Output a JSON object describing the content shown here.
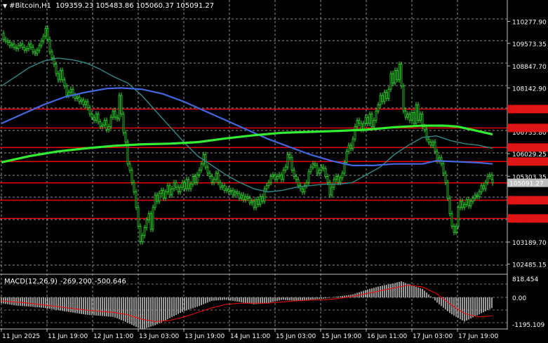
{
  "header": {
    "symbol": "#Bitcoin,H1",
    "ohlc": "109359.23 105483.86 105060.37 105091.27"
  },
  "price_axis": {
    "labels": [
      "110277.90",
      "109573.35",
      "108847.70",
      "108142.90",
      "106733.80",
      "106029.25",
      "105303.35",
      "103189.70",
      "102485.15"
    ]
  },
  "levels": [
    {
      "value": "107461.17",
      "color": "#e01515",
      "bg": "#e01515"
    },
    {
      "value": "106855.59",
      "color": "#e01515",
      "bg": "#e01515"
    },
    {
      "value": "106227.00",
      "color": "#e01515",
      "bg": "#e01515"
    },
    {
      "value": "105776.11",
      "color": "#e01515",
      "bg": "#e01515"
    },
    {
      "value": "105091.27",
      "color": "#ffffff",
      "bg": "#bdbdbd"
    },
    {
      "value": "104532.98",
      "color": "#e01515",
      "bg": "#e01515"
    },
    {
      "value": "103947.55",
      "color": "#e01515",
      "bg": "#e01515"
    }
  ],
  "macd": {
    "name": "MACD(12,26,9)",
    "main": "-269.200",
    "signal": "-500.646",
    "axis_labels": [
      "818.454",
      "0.00",
      "-1195.109"
    ]
  },
  "time_axis": {
    "labels": [
      "11 Jun 2025",
      "11 Jun 19:00",
      "12 Jun 11:00",
      "13 Jun 03:00",
      "13 Jun 19:00",
      "14 Jun 11:00",
      "15 Jun 03:00",
      "15 Jun 19:00",
      "16 Jun 11:00",
      "17 Jun 03:00",
      "17 Jun 19:00"
    ]
  },
  "colors": {
    "background": "#000000",
    "candles": "#33dd33",
    "grid": "#c0c0c0",
    "level_line": "#ff0000",
    "ma_fast": "#2e8b8b",
    "ma_mid": "#4169e1",
    "ma_slow": "#33ee33",
    "macd_hist": "#c0c0c0",
    "macd_signal": "#ff0000"
  },
  "chart_data": {
    "type": "line",
    "title": "#Bitcoin,H1",
    "y_range": [
      102200,
      110650
    ],
    "close_path": [
      [
        0,
        109900
      ],
      [
        3,
        109700
      ],
      [
        6,
        109650
      ],
      [
        9,
        109600
      ],
      [
        12,
        109500
      ],
      [
        15,
        109550
      ],
      [
        18,
        109450
      ],
      [
        21,
        109400
      ],
      [
        24,
        109500
      ],
      [
        27,
        109550
      ],
      [
        30,
        109450
      ],
      [
        33,
        109350
      ],
      [
        36,
        109400
      ],
      [
        39,
        109550
      ],
      [
        42,
        109450
      ],
      [
        45,
        109300
      ],
      [
        48,
        109250
      ],
      [
        51,
        109350
      ],
      [
        54,
        109500
      ],
      [
        57,
        109650
      ],
      [
        60,
        109800
      ],
      [
        63,
        110050
      ],
      [
        66,
        109700
      ],
      [
        69,
        109300
      ],
      [
        72,
        109100
      ],
      [
        75,
        108900
      ],
      [
        78,
        108600
      ],
      [
        81,
        108400
      ],
      [
        84,
        108700
      ],
      [
        87,
        108400
      ],
      [
        90,
        108200
      ],
      [
        93,
        107900
      ],
      [
        96,
        108000
      ],
      [
        99,
        108100
      ],
      [
        102,
        107900
      ],
      [
        105,
        107800
      ],
      [
        108,
        107850
      ],
      [
        111,
        107700
      ],
      [
        114,
        107750
      ],
      [
        117,
        107600
      ],
      [
        120,
        107700
      ],
      [
        123,
        107500
      ],
      [
        126,
        107300
      ],
      [
        129,
        107200
      ],
      [
        132,
        107100
      ],
      [
        135,
        107300
      ],
      [
        138,
        107050
      ],
      [
        141,
        106900
      ],
      [
        144,
        106950
      ],
      [
        147,
        107100
      ],
      [
        150,
        106800
      ],
      [
        153,
        106900
      ],
      [
        156,
        107200
      ],
      [
        159,
        107400
      ],
      [
        162,
        107200
      ],
      [
        165,
        107150
      ],
      [
        168,
        107900
      ],
      [
        171,
        107300
      ],
      [
        174,
        106700
      ],
      [
        177,
        106400
      ],
      [
        180,
        105700
      ],
      [
        183,
        105500
      ],
      [
        186,
        105100
      ],
      [
        189,
        104800
      ],
      [
        192,
        104300
      ],
      [
        195,
        103700
      ],
      [
        198,
        103200
      ],
      [
        201,
        103400
      ],
      [
        204,
        103650
      ],
      [
        207,
        103900
      ],
      [
        210,
        104100
      ],
      [
        213,
        103600
      ],
      [
        216,
        104300
      ],
      [
        219,
        104700
      ],
      [
        222,
        104500
      ],
      [
        225,
        104750
      ],
      [
        228,
        104850
      ],
      [
        231,
        104600
      ],
      [
        234,
        104800
      ],
      [
        237,
        105000
      ],
      [
        240,
        104700
      ],
      [
        243,
        104900
      ],
      [
        246,
        105100
      ],
      [
        249,
        104950
      ],
      [
        252,
        104800
      ],
      [
        255,
        104950
      ],
      [
        258,
        105100
      ],
      [
        261,
        104900
      ],
      [
        264,
        105200
      ],
      [
        267,
        104900
      ],
      [
        270,
        105050
      ],
      [
        273,
        105300
      ],
      [
        276,
        105100
      ],
      [
        279,
        105350
      ],
      [
        282,
        105500
      ],
      [
        285,
        105700
      ],
      [
        288,
        106000
      ],
      [
        291,
        105600
      ],
      [
        294,
        105400
      ],
      [
        297,
        105300
      ],
      [
        300,
        105100
      ],
      [
        303,
        105200
      ],
      [
        306,
        105400
      ],
      [
        309,
        105100
      ],
      [
        312,
        104950
      ],
      [
        315,
        105000
      ],
      [
        318,
        104850
      ],
      [
        321,
        104900
      ],
      [
        324,
        104800
      ],
      [
        327,
        104850
      ],
      [
        330,
        104700
      ],
      [
        333,
        104800
      ],
      [
        336,
        104750
      ],
      [
        339,
        104600
      ],
      [
        342,
        104700
      ],
      [
        345,
        104550
      ],
      [
        348,
        104650
      ],
      [
        351,
        104600
      ],
      [
        354,
        104450
      ],
      [
        357,
        104500
      ],
      [
        360,
        104300
      ],
      [
        363,
        104550
      ],
      [
        366,
        104400
      ],
      [
        369,
        104650
      ],
      [
        372,
        104500
      ],
      [
        375,
        104900
      ],
      [
        378,
        105000
      ],
      [
        381,
        105100
      ],
      [
        384,
        105300
      ],
      [
        387,
        105350
      ],
      [
        390,
        105200
      ],
      [
        393,
        105300
      ],
      [
        396,
        105350
      ],
      [
        399,
        105200
      ],
      [
        402,
        105500
      ],
      [
        405,
        105600
      ],
      [
        408,
        106000
      ],
      [
        411,
        105900
      ],
      [
        414,
        105500
      ],
      [
        417,
        105300
      ],
      [
        420,
        105200
      ],
      [
        423,
        105000
      ],
      [
        426,
        104900
      ],
      [
        429,
        104800
      ],
      [
        432,
        105000
      ],
      [
        435,
        105100
      ],
      [
        438,
        105450
      ],
      [
        441,
        105600
      ],
      [
        444,
        105700
      ],
      [
        447,
        105650
      ],
      [
        450,
        105400
      ],
      [
        453,
        105500
      ],
      [
        456,
        105600
      ],
      [
        459,
        105550
      ],
      [
        462,
        105300
      ],
      [
        465,
        105100
      ],
      [
        468,
        104700
      ],
      [
        471,
        104950
      ],
      [
        474,
        105200
      ],
      [
        477,
        105300
      ],
      [
        480,
        105100
      ],
      [
        483,
        105250
      ],
      [
        486,
        105400
      ],
      [
        489,
        105750
      ],
      [
        492,
        106100
      ],
      [
        495,
        106300
      ],
      [
        498,
        106200
      ],
      [
        501,
        106500
      ],
      [
        504,
        106900
      ],
      [
        507,
        107100
      ],
      [
        510,
        107000
      ],
      [
        513,
        106800
      ],
      [
        516,
        107000
      ],
      [
        519,
        107200
      ],
      [
        522,
        107000
      ],
      [
        525,
        107300
      ],
      [
        528,
        106900
      ],
      [
        531,
        107100
      ],
      [
        534,
        107400
      ],
      [
        537,
        107600
      ],
      [
        540,
        107900
      ],
      [
        543,
        107700
      ],
      [
        546,
        108000
      ],
      [
        549,
        107800
      ],
      [
        552,
        108100
      ],
      [
        555,
        108600
      ],
      [
        558,
        108300
      ],
      [
        561,
        108700
      ],
      [
        564,
        108400
      ],
      [
        567,
        108900
      ],
      [
        570,
        108200
      ],
      [
        573,
        107400
      ],
      [
        576,
        107200
      ],
      [
        579,
        107300
      ],
      [
        582,
        107100
      ],
      [
        585,
        107350
      ],
      [
        588,
        107000
      ],
      [
        591,
        107600
      ],
      [
        594,
        107100
      ],
      [
        597,
        107300
      ],
      [
        600,
        106900
      ],
      [
        603,
        106800
      ],
      [
        606,
        106500
      ],
      [
        609,
        106400
      ],
      [
        612,
        106300
      ],
      [
        615,
        106400
      ],
      [
        618,
        106100
      ],
      [
        621,
        105800
      ],
      [
        624,
        105900
      ],
      [
        627,
        105700
      ],
      [
        630,
        105400
      ],
      [
        633,
        105100
      ],
      [
        636,
        104600
      ],
      [
        639,
        104100
      ],
      [
        642,
        103700
      ],
      [
        645,
        103500
      ],
      [
        648,
        103700
      ],
      [
        651,
        104300
      ],
      [
        654,
        104500
      ],
      [
        657,
        104300
      ],
      [
        660,
        104400
      ],
      [
        663,
        104550
      ],
      [
        666,
        104350
      ],
      [
        669,
        104500
      ],
      [
        672,
        104600
      ],
      [
        675,
        104700
      ],
      [
        678,
        104650
      ],
      [
        681,
        104800
      ],
      [
        684,
        105000
      ],
      [
        687,
        104900
      ],
      [
        690,
        105100
      ],
      [
        693,
        105300
      ],
      [
        696,
        105350
      ],
      [
        699,
        105200
      ],
      [
        700,
        105091
      ]
    ],
    "ma_fast_path": [
      [
        0,
        108200
      ],
      [
        20,
        108500
      ],
      [
        40,
        108800
      ],
      [
        60,
        109000
      ],
      [
        80,
        109100
      ],
      [
        100,
        109050
      ],
      [
        120,
        108950
      ],
      [
        140,
        108750
      ],
      [
        160,
        108500
      ],
      [
        180,
        108300
      ],
      [
        200,
        107900
      ],
      [
        220,
        107400
      ],
      [
        240,
        106900
      ],
      [
        260,
        106400
      ],
      [
        280,
        105950
      ],
      [
        300,
        105650
      ],
      [
        320,
        105350
      ],
      [
        340,
        105100
      ],
      [
        360,
        104900
      ],
      [
        380,
        104800
      ],
      [
        400,
        104850
      ],
      [
        420,
        104950
      ],
      [
        440,
        105000
      ],
      [
        460,
        105050
      ],
      [
        480,
        105050
      ],
      [
        500,
        105100
      ],
      [
        520,
        105350
      ],
      [
        540,
        105600
      ],
      [
        560,
        106000
      ],
      [
        580,
        106300
      ],
      [
        600,
        106550
      ],
      [
        620,
        106600
      ],
      [
        640,
        106450
      ],
      [
        660,
        106350
      ],
      [
        680,
        106300
      ],
      [
        700,
        106200
      ]
    ],
    "ma_mid_path": [
      [
        0,
        107000
      ],
      [
        30,
        107300
      ],
      [
        60,
        107600
      ],
      [
        90,
        107850
      ],
      [
        120,
        108000
      ],
      [
        150,
        108120
      ],
      [
        170,
        108140
      ],
      [
        200,
        108100
      ],
      [
        230,
        107950
      ],
      [
        260,
        107700
      ],
      [
        290,
        107400
      ],
      [
        320,
        107100
      ],
      [
        350,
        106800
      ],
      [
        380,
        106500
      ],
      [
        410,
        106250
      ],
      [
        440,
        106000
      ],
      [
        470,
        105800
      ],
      [
        500,
        105650
      ],
      [
        530,
        105650
      ],
      [
        560,
        105700
      ],
      [
        580,
        105700
      ],
      [
        600,
        105700
      ],
      [
        620,
        105800
      ],
      [
        640,
        105780
      ],
      [
        660,
        105760
      ],
      [
        680,
        105740
      ],
      [
        700,
        105700
      ]
    ],
    "ma_slow_path": [
      [
        0,
        105750
      ],
      [
        40,
        105950
      ],
      [
        80,
        106100
      ],
      [
        120,
        106200
      ],
      [
        160,
        106280
      ],
      [
        200,
        106330
      ],
      [
        240,
        106350
      ],
      [
        280,
        106400
      ],
      [
        320,
        106520
      ],
      [
        360,
        106620
      ],
      [
        400,
        106700
      ],
      [
        440,
        106730
      ],
      [
        480,
        106760
      ],
      [
        520,
        106800
      ],
      [
        560,
        106880
      ],
      [
        600,
        106930
      ],
      [
        630,
        106930
      ],
      [
        650,
        106900
      ],
      [
        670,
        106800
      ],
      [
        690,
        106700
      ],
      [
        700,
        106650
      ]
    ],
    "macd_hist_path": [
      [
        0,
        -0.25
      ],
      [
        20,
        -0.35
      ],
      [
        40,
        -0.4
      ],
      [
        60,
        -0.45
      ],
      [
        80,
        -0.55
      ],
      [
        100,
        -0.65
      ],
      [
        120,
        -0.75
      ],
      [
        140,
        -0.8
      ],
      [
        160,
        -0.85
      ],
      [
        180,
        -1.1
      ],
      [
        200,
        -1.4
      ],
      [
        220,
        -1.2
      ],
      [
        240,
        -0.9
      ],
      [
        260,
        -0.6
      ],
      [
        280,
        -0.4
      ],
      [
        300,
        -0.15
      ],
      [
        320,
        -0.1
      ],
      [
        340,
        -0.2
      ],
      [
        360,
        -0.3
      ],
      [
        380,
        -0.25
      ],
      [
        400,
        -0.1
      ],
      [
        420,
        -0.15
      ],
      [
        440,
        -0.1
      ],
      [
        460,
        -0.05
      ],
      [
        480,
        0.05
      ],
      [
        500,
        0.15
      ],
      [
        520,
        0.4
      ],
      [
        540,
        0.6
      ],
      [
        560,
        0.75
      ],
      [
        570,
        0.85
      ],
      [
        580,
        0.7
      ],
      [
        600,
        0.45
      ],
      [
        620,
        -0.2
      ],
      [
        640,
        -0.7
      ],
      [
        660,
        -1.05
      ],
      [
        680,
        -0.75
      ],
      [
        700,
        -0.45
      ]
    ],
    "macd_signal_path": [
      [
        0,
        -0.15
      ],
      [
        40,
        -0.25
      ],
      [
        80,
        -0.4
      ],
      [
        120,
        -0.55
      ],
      [
        160,
        -0.65
      ],
      [
        180,
        -0.75
      ],
      [
        200,
        -0.95
      ],
      [
        220,
        -1.05
      ],
      [
        240,
        -1.0
      ],
      [
        260,
        -0.85
      ],
      [
        280,
        -0.65
      ],
      [
        300,
        -0.45
      ],
      [
        320,
        -0.3
      ],
      [
        340,
        -0.25
      ],
      [
        360,
        -0.25
      ],
      [
        380,
        -0.25
      ],
      [
        400,
        -0.2
      ],
      [
        420,
        -0.15
      ],
      [
        440,
        -0.12
      ],
      [
        460,
        -0.1
      ],
      [
        480,
        -0.05
      ],
      [
        500,
        0.05
      ],
      [
        520,
        0.2
      ],
      [
        540,
        0.35
      ],
      [
        560,
        0.5
      ],
      [
        580,
        0.65
      ],
      [
        600,
        0.55
      ],
      [
        620,
        0.2
      ],
      [
        640,
        -0.3
      ],
      [
        660,
        -0.7
      ],
      [
        680,
        -0.85
      ],
      [
        700,
        -0.8
      ]
    ]
  }
}
